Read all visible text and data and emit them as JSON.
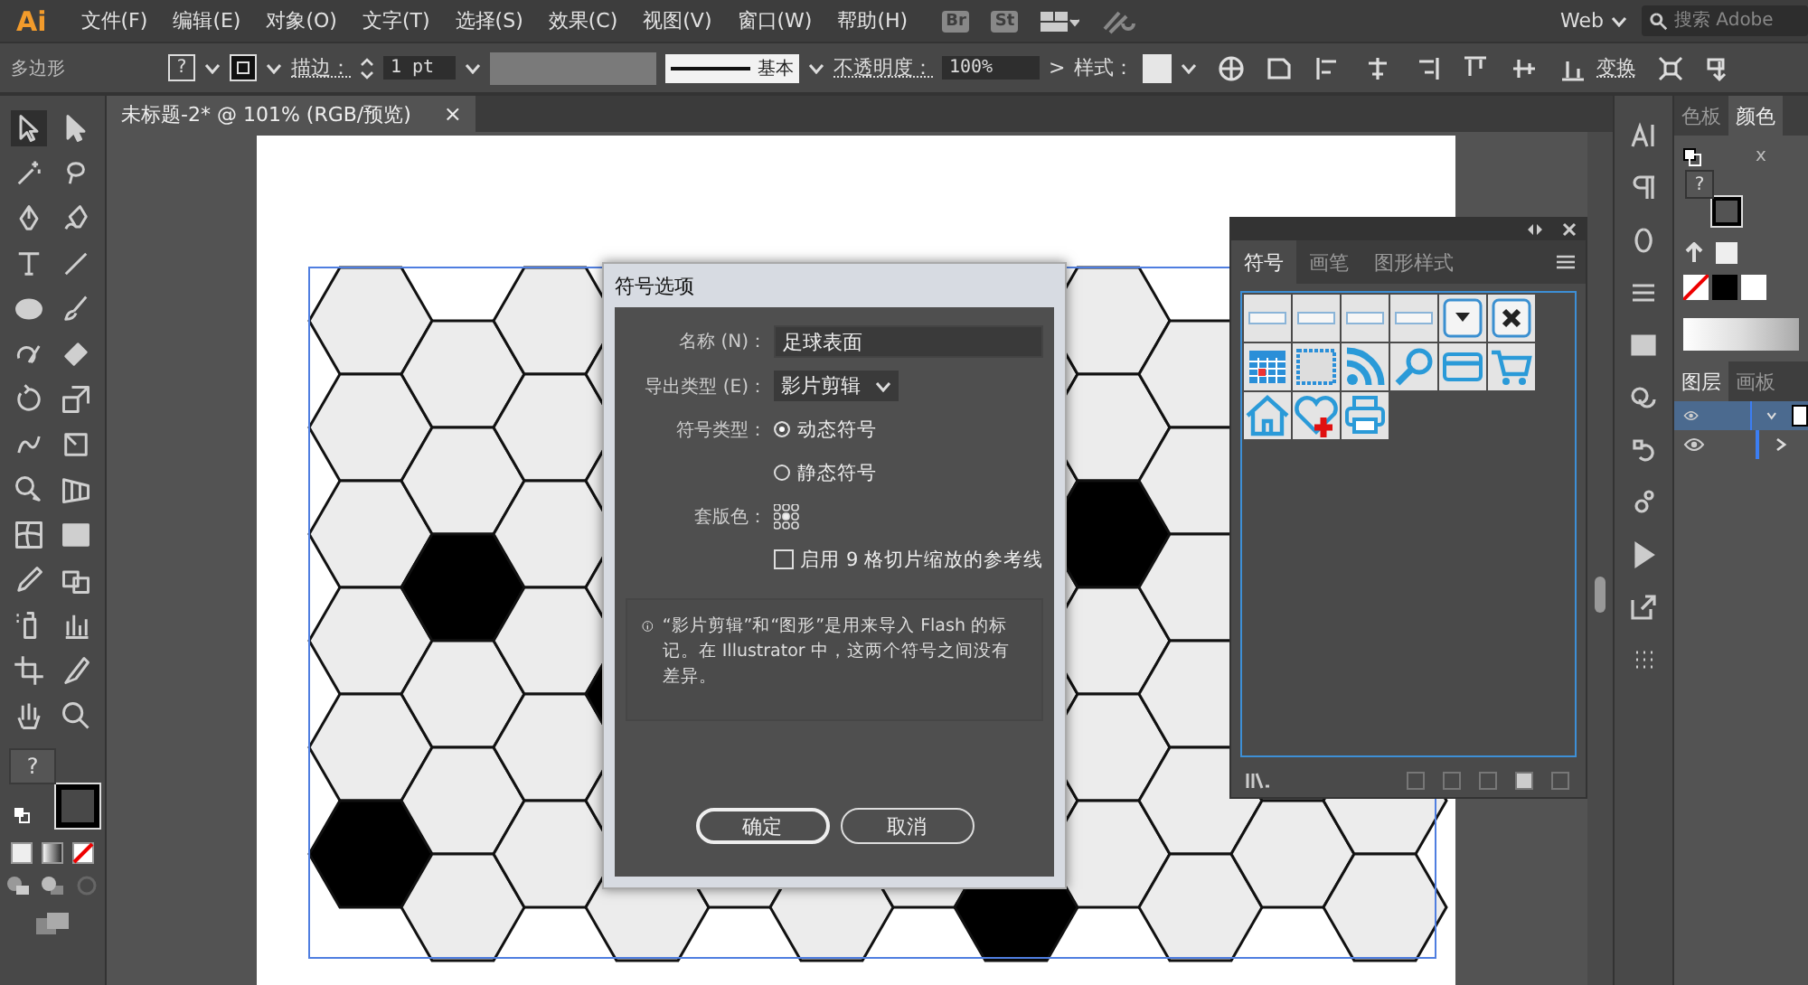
{
  "app": {
    "logo": "Ai",
    "bridge": "Br",
    "stock": "St",
    "workspace": "Web",
    "search": {
      "placeholder": "搜索 Adobe"
    }
  },
  "menu": [
    "文件(F)",
    "编辑(E)",
    "对象(O)",
    "文字(T)",
    "选择(S)",
    "效果(C)",
    "视图(V)",
    "窗口(W)",
    "帮助(H)"
  ],
  "control_bar": {
    "object_type": "多边形",
    "fill_label": "?",
    "stroke_label": "描边：",
    "stroke_weight": "1 pt",
    "profile": "基本",
    "opacity_label": "不透明度：",
    "opacity": "100%",
    "more": ">",
    "style_label": "样式：",
    "transform": "变换"
  },
  "document_tab": {
    "title": "未标题-2* @ 101% (RGB/预览)",
    "close": "×"
  },
  "toolbar": {
    "fill_label": "?"
  },
  "dialog": {
    "title": "符号选项",
    "name_label": "名称 (N)：",
    "name_value": "足球表面",
    "export_label": "导出类型 (E)：",
    "export_value": "影片剪辑",
    "type_label": "符号类型：",
    "types": [
      {
        "label": "动态符号",
        "selected": true
      },
      {
        "label": "静态符号",
        "selected": false
      }
    ],
    "registration_label": "套版色：",
    "nine_slice": {
      "label": "启用 9 格切片缩放的参考线",
      "checked": false
    },
    "info": "“影片剪辑”和“图形”是用来导入 Flash 的标记。在 Illustrator 中，这两个符号之间没有差异。",
    "buttons": [
      {
        "label": "确定",
        "default": true
      },
      {
        "label": "取消",
        "default": false
      }
    ]
  },
  "symbols_panel": {
    "tabs": [
      {
        "label": "符号",
        "selected": true
      },
      {
        "label": "画笔",
        "selected": false
      },
      {
        "label": "图形样式",
        "selected": false
      }
    ]
  },
  "color_panel": {
    "tabs": [
      {
        "label": "色板",
        "selected": false
      },
      {
        "label": "颜色",
        "selected": true
      }
    ],
    "fill_label": "?",
    "x_label": "x"
  },
  "layers_panel": {
    "tabs": [
      {
        "label": "图层",
        "selected": true
      },
      {
        "label": "画板",
        "selected": false
      }
    ],
    "layers": [
      {
        "selected": true,
        "expanded": true
      },
      {
        "selected": false,
        "expanded": false
      }
    ]
  }
}
